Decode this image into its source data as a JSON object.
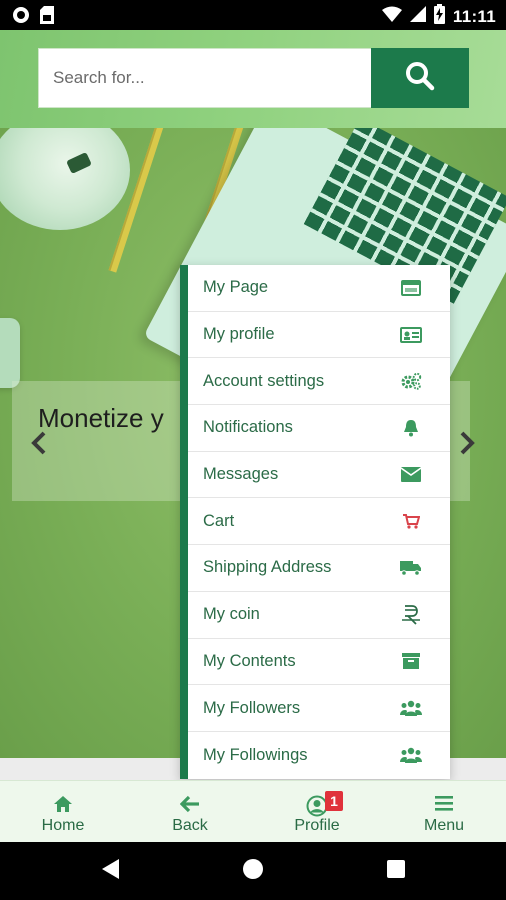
{
  "status_bar": {
    "time": "11:11",
    "icons": [
      "circle-notification-icon",
      "sim-card-icon",
      "wifi-icon",
      "signal-icon",
      "battery-charging-icon"
    ]
  },
  "search": {
    "placeholder": "Search for...",
    "value": "",
    "button_icon": "search-icon"
  },
  "colors": {
    "primary": "#1c7a4b",
    "header_green": "#8fd17e",
    "badge_red": "#e0323b",
    "menu_text": "#2b6b47"
  },
  "hero": {
    "slide_title": "Monetize y",
    "prev_icon": "chevron-left-icon",
    "next_icon": "chevron-right-icon"
  },
  "profile_menu": {
    "items": [
      {
        "label": "My Page",
        "icon": "page-card-icon"
      },
      {
        "label": "My profile",
        "icon": "id-card-icon"
      },
      {
        "label": "Account settings",
        "icon": "gears-icon"
      },
      {
        "label": "Notifications",
        "icon": "bell-icon"
      },
      {
        "label": "Messages",
        "icon": "envelope-icon"
      },
      {
        "label": "Cart",
        "icon": "cart-icon"
      },
      {
        "label": "Shipping Address",
        "icon": "truck-icon"
      },
      {
        "label": "My coin",
        "icon": "coin-icon"
      },
      {
        "label": "My Contents",
        "icon": "archive-icon"
      },
      {
        "label": "My Followers",
        "icon": "users-icon"
      },
      {
        "label": "My Followings",
        "icon": "users-icon"
      }
    ]
  },
  "bottom_nav": {
    "items": [
      {
        "label": "Home",
        "icon": "home-icon"
      },
      {
        "label": "Back",
        "icon": "arrow-left-icon"
      },
      {
        "label": "Profile",
        "icon": "user-circle-icon",
        "badge": "1"
      },
      {
        "label": "Menu",
        "icon": "hamburger-icon"
      }
    ]
  },
  "system_nav": {
    "buttons": [
      "back-triangle-icon",
      "home-circle-icon",
      "recents-square-icon"
    ]
  }
}
